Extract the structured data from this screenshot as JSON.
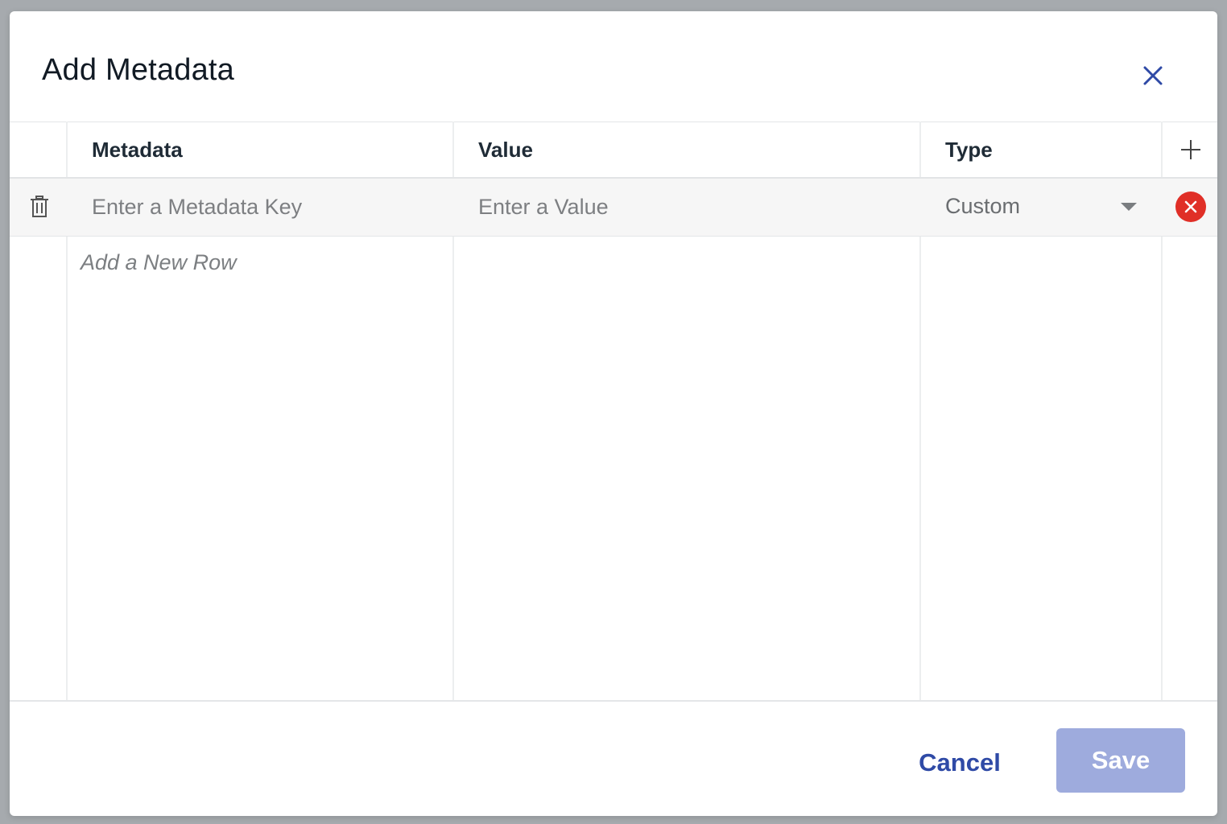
{
  "dialog": {
    "title": "Add Metadata",
    "close_icon": "close-icon"
  },
  "table": {
    "columns": [
      {
        "label": "Metadata"
      },
      {
        "label": "Value"
      },
      {
        "label": "Type"
      }
    ],
    "add_column_icon": "plus-icon",
    "rows": [
      {
        "key_placeholder": "Enter a Metadata Key",
        "key_value": "",
        "value_placeholder": "Enter a Value",
        "value_value": "",
        "type": "Custom",
        "delete_icon": "trash-icon",
        "remove_icon": "remove-circle-icon"
      }
    ],
    "add_row_label": "Add a New Row"
  },
  "footer": {
    "cancel_label": "Cancel",
    "save_label": "Save",
    "save_disabled": true
  },
  "colors": {
    "accent": "#2f4aa6",
    "save_disabled_bg": "#9eabdd",
    "remove_red": "#e02f27"
  }
}
